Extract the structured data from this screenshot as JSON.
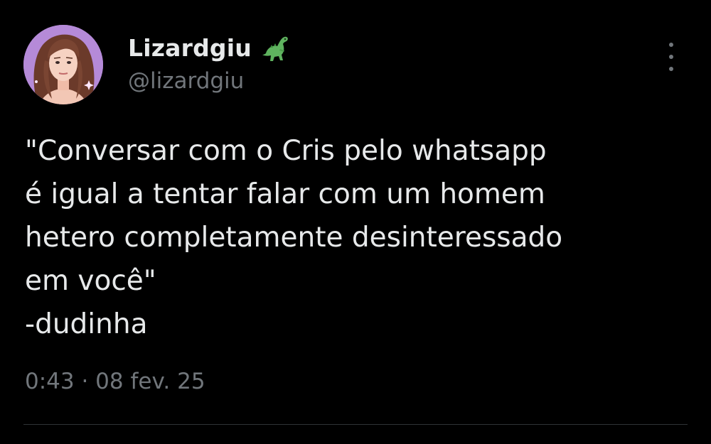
{
  "author": {
    "display_name": "Lizardgiu",
    "handle": "@lizardgiu",
    "avatar_icon": "illustrated-woman-avatar",
    "badge_icon": "dinosaur-emoji-icon"
  },
  "tweet": {
    "text_lines": [
      "\"Conversar com o Cris pelo whatsapp",
      "é igual a tentar falar com um homem",
      "hetero completamente desinteressado",
      "em você\"",
      "-dudinha"
    ],
    "timestamp": "0:43 · 08 fev. 25"
  },
  "colors": {
    "background": "#000000",
    "primary_text": "#e7e9ea",
    "secondary_text": "#71767b",
    "divider": "#2f3336",
    "avatar_bg": "#b58ad8",
    "dino": "#5fb35f"
  },
  "actions": {
    "more_icon": "more-vertical-icon"
  }
}
